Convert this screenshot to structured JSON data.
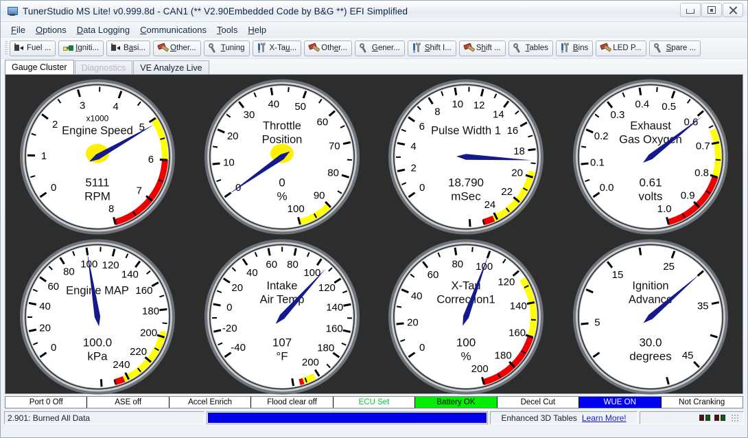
{
  "window": {
    "title": "TunerStudio MS Lite! v0.999.8d - CAN1 (** V2.90Embedded Code by B&G **) EFI Simplified",
    "icon": "app-icon",
    "controls": [
      {
        "name": "minimize-button",
        "glyph": "minimize-icon"
      },
      {
        "name": "maximize-button",
        "glyph": "maximize-icon"
      },
      {
        "name": "close-button",
        "glyph": "close-icon"
      }
    ]
  },
  "menubar": [
    {
      "label": "File",
      "mnemonic": "F"
    },
    {
      "label": "Options",
      "mnemonic": "O"
    },
    {
      "label": "Data Logging",
      "mnemonic": "D"
    },
    {
      "label": "Communications",
      "mnemonic": "C"
    },
    {
      "label": "Tools",
      "mnemonic": "T"
    },
    {
      "label": "Help",
      "mnemonic": "H"
    }
  ],
  "toolbar": [
    {
      "label": "Fuel ...",
      "icon": "injector-icon",
      "mnemonic": ""
    },
    {
      "label": "Igniti...",
      "icon": "spark-icon",
      "mnemonic": "I"
    },
    {
      "label": "Basi...",
      "icon": "injector-icon",
      "mnemonic": "a"
    },
    {
      "label": "Other...",
      "icon": "hammer-icon",
      "mnemonic": "O"
    },
    {
      "label": "Tuning",
      "icon": "wrench-icon",
      "mnemonic": "T"
    },
    {
      "label": "X-Tau...",
      "icon": "tools-icon",
      "mnemonic": "u"
    },
    {
      "label": "Other...",
      "icon": "hammer-icon",
      "mnemonic": "e"
    },
    {
      "label": "Gener...",
      "icon": "wrench-icon",
      "mnemonic": "G"
    },
    {
      "label": "Shift I...",
      "icon": "tools-icon",
      "mnemonic": "S"
    },
    {
      "label": "Shift ...",
      "icon": "hammer-icon",
      "mnemonic": "h"
    },
    {
      "label": "Tables",
      "icon": "wrench-icon",
      "mnemonic": "T"
    },
    {
      "label": "Bins",
      "icon": "tools-icon",
      "mnemonic": "B"
    },
    {
      "label": "LED P...",
      "icon": "hammer-icon",
      "mnemonic": ""
    },
    {
      "label": "Spare ...",
      "icon": "wrench-icon",
      "mnemonic": "S"
    }
  ],
  "tabs": [
    {
      "label": "Gauge Cluster",
      "state": "active"
    },
    {
      "label": "Diagnostics",
      "state": "disabled"
    },
    {
      "label": "VE Analyze Live",
      "state": "normal"
    }
  ],
  "gauges": [
    {
      "name": "engine-speed",
      "title": [
        "Engine Speed"
      ],
      "above_title": "x1000",
      "value": "5111",
      "units": "RPM",
      "min": 0,
      "max": 8,
      "needle": 5.111,
      "major_step": 1,
      "minor_per_major": 2,
      "labels": [
        "0",
        "1",
        "2",
        "3",
        "4",
        "5",
        "6",
        "7",
        "8"
      ],
      "start_angle": 215,
      "sweep": 290,
      "hub": true,
      "bands": [
        {
          "from": 5.0,
          "to": 6.0,
          "color": "#ffff00"
        },
        {
          "from": 6.0,
          "to": 8.0,
          "color": "#ee0000"
        }
      ]
    },
    {
      "name": "throttle-position",
      "title": [
        "Throttle",
        "Position"
      ],
      "above_title": "",
      "value": "0",
      "units": "%",
      "min": 0,
      "max": 100,
      "needle": 0,
      "major_step": 10,
      "minor_per_major": 2,
      "labels": [
        "0",
        "10",
        "20",
        "30",
        "40",
        "50",
        "60",
        "70",
        "80",
        "90",
        "100"
      ],
      "start_angle": 215,
      "sweep": 290,
      "hub": true,
      "bands": [
        {
          "from": 90,
          "to": 100,
          "color": "#ffff00"
        }
      ]
    },
    {
      "name": "pulse-width-1",
      "title": [
        "Pulse Width 1"
      ],
      "above_title": "",
      "value": "18.790",
      "units": "mSec",
      "min": 0,
      "max": 25,
      "needle": 18.79,
      "major_step": 2,
      "minor_per_major": 2,
      "labels": [
        "0",
        "2",
        "4",
        "6",
        "8",
        "10",
        "12",
        "14",
        "16",
        "18",
        "20",
        "22",
        "24"
      ],
      "start_angle": 215,
      "sweep": 290,
      "hub": false,
      "bands": [
        {
          "from": 19.6,
          "to": 24.2,
          "color": "#ffff00"
        },
        {
          "from": 24.2,
          "to": 25.0,
          "color": "#ee0000"
        }
      ]
    },
    {
      "name": "exhaust-gas-oxygen",
      "title": [
        "Exhaust",
        "Gas Oxygen"
      ],
      "above_title": "",
      "value": "0.61",
      "units": "volts",
      "min": 0,
      "max": 1.0,
      "needle": 0.61,
      "major_step": 0.1,
      "minor_per_major": 2,
      "labels": [
        "0.0",
        "0.1",
        "0.2",
        "0.3",
        "0.4",
        "0.5",
        "0.6",
        "0.7",
        "0.8",
        "0.9",
        "1.0"
      ],
      "start_angle": 215,
      "sweep": 290,
      "hub": false,
      "bands": [
        {
          "from": 0.66,
          "to": 0.8,
          "color": "#ffff00"
        },
        {
          "from": 0.8,
          "to": 1.0,
          "color": "#ee0000"
        }
      ]
    },
    {
      "name": "engine-map",
      "title": [
        "Engine MAP"
      ],
      "above_title": "",
      "value": "100.0",
      "units": "kPa",
      "min": 0,
      "max": 250,
      "needle": 100,
      "major_step": 20,
      "minor_per_major": 2,
      "labels": [
        "0",
        "20",
        "40",
        "60",
        "80",
        "100",
        "120",
        "140",
        "160",
        "180",
        "200",
        "220",
        "240"
      ],
      "start_angle": 215,
      "sweep": 290,
      "hub": false,
      "bands": [
        {
          "from": 196,
          "to": 243,
          "color": "#ffff00"
        },
        {
          "from": 243,
          "to": 250,
          "color": "#ee0000"
        }
      ]
    },
    {
      "name": "intake-air-temp",
      "title": [
        "Intake",
        "Air Temp"
      ],
      "above_title": "",
      "value": "107",
      "units": "°F",
      "min": -40,
      "max": 215,
      "needle": 107,
      "major_step": 20,
      "minor_per_major": 2,
      "labels": [
        "-40",
        "-20",
        "0",
        "20",
        "40",
        "60",
        "80",
        "100",
        "120",
        "140",
        "160",
        "180",
        "200"
      ],
      "start_angle": 215,
      "sweep": 290,
      "hub": false,
      "bands": [
        {
          "from": 203,
          "to": 212,
          "color": "#ffff00"
        },
        {
          "from": 212,
          "to": 215,
          "color": "#ee0000"
        }
      ]
    },
    {
      "name": "x-tau-correction1",
      "title": [
        "X-Tau",
        "Correction1"
      ],
      "above_title": "",
      "value": "100",
      "units": "%",
      "min": 0,
      "max": 200,
      "needle": 100,
      "major_step": 20,
      "minor_per_major": 2,
      "labels": [
        "0",
        "20",
        "40",
        "60",
        "80",
        "100",
        "120",
        "140",
        "160",
        "180",
        "200"
      ],
      "start_angle": 215,
      "sweep": 290,
      "hub": false,
      "bands": [
        {
          "from": 125,
          "to": 160,
          "color": "#ffff00"
        },
        {
          "from": 160,
          "to": 200,
          "color": "#ee0000"
        }
      ]
    },
    {
      "name": "ignition-advance",
      "title": [
        "Ignition",
        "Advance"
      ],
      "above_title": "",
      "value": "30.0",
      "units": "degrees",
      "min": 0,
      "max": 50,
      "needle": 30,
      "major_step": 5,
      "minor_per_major": 1,
      "labels": [
        "",
        "5",
        "",
        "15",
        "",
        "25",
        "",
        "35",
        "",
        "45",
        ""
      ],
      "start_angle": 215,
      "sweep": 290,
      "hub": false,
      "bands": []
    }
  ],
  "status_indicators": [
    {
      "label": "Port 0 Off",
      "bg": "#ffffff",
      "fg": "#000000"
    },
    {
      "label": "ASE off",
      "bg": "#ffffff",
      "fg": "#000000"
    },
    {
      "label": "Accel Enrich",
      "bg": "#ffffff",
      "fg": "#000000"
    },
    {
      "label": "Flood clear off",
      "bg": "#ffffff",
      "fg": "#000000"
    },
    {
      "label": "ECU Set",
      "bg": "#ffffff",
      "fg": "#00cc33"
    },
    {
      "label": "Battery OK",
      "bg": "#00ee00",
      "fg": "#000000"
    },
    {
      "label": "Decel Cut",
      "bg": "#ffffff",
      "fg": "#000000"
    },
    {
      "label": "WUE ON",
      "bg": "#0000ee",
      "fg": "#ffffff"
    },
    {
      "label": "Not Cranking",
      "bg": "#ffffff",
      "fg": "#000000"
    }
  ],
  "statusbar": {
    "message": "2.901: Burned All Data",
    "progress_percent": 100,
    "progress_color": "#0000e6",
    "ad_text": "Enhanced 3D Tables",
    "ad_link": "Learn More!"
  }
}
